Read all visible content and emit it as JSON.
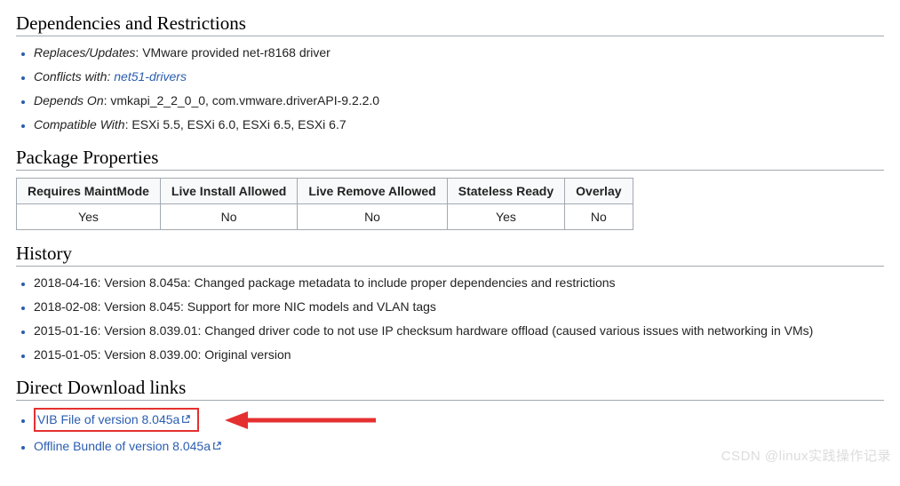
{
  "sections": {
    "deps": {
      "heading": "Dependencies and Restrictions",
      "items": {
        "replaces": {
          "label": "Replaces/Updates",
          "sep": ": ",
          "value": "VMware provided net-r8168 driver"
        },
        "conflicts": {
          "label": "Conflicts with:",
          "sep": " ",
          "link": "net51-drivers"
        },
        "depends": {
          "label": "Depends On",
          "sep": ": ",
          "value": "vmkapi_2_2_0_0, com.vmware.driverAPI-9.2.2.0"
        },
        "compatible": {
          "label": "Compatible With",
          "sep": ": ",
          "value": "ESXi 5.5, ESXi 6.0, ESXi 6.5, ESXi 6.7"
        }
      }
    },
    "pkg": {
      "heading": "Package Properties",
      "headers": {
        "c0": "Requires MaintMode",
        "c1": "Live Install Allowed",
        "c2": "Live Remove Allowed",
        "c3": "Stateless Ready",
        "c4": "Overlay"
      },
      "row": {
        "c0": "Yes",
        "c1": "No",
        "c2": "No",
        "c3": "Yes",
        "c4": "No"
      }
    },
    "history": {
      "heading": "History",
      "items": {
        "i0": "2018-04-16: Version 8.045a: Changed package metadata to include proper dependencies and restrictions",
        "i1": "2018-02-08: Version 8.045: Support for more NIC models and VLAN tags",
        "i2": "2015-01-16: Version 8.039.01: Changed driver code to not use IP checksum hardware offload (caused various issues with networking in VMs)",
        "i3": "2015-01-05: Version 8.039.00: Original version"
      }
    },
    "downloads": {
      "heading": "Direct Download links",
      "vib": "VIB File of version 8.045a",
      "bundle": "Offline Bundle of version 8.045a"
    }
  },
  "watermark": "CSDN @linux实践操作记录"
}
